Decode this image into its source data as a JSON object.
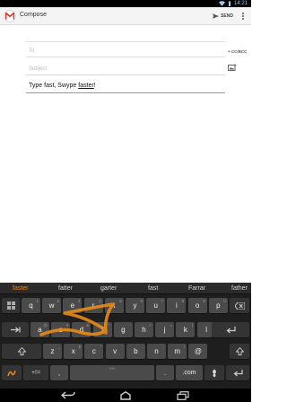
{
  "status_bar": {
    "time": "14:21",
    "icons": [
      "wifi-icon",
      "battery-icon"
    ]
  },
  "action_bar": {
    "title": "Compose",
    "send_label": "SEND",
    "icons": {
      "app": "gmail-logo-icon",
      "send": "send-icon",
      "menu": "overflow-menu-icon"
    }
  },
  "compose": {
    "to_placeholder": "To",
    "cc_bcc_label": "+ CC/BCC",
    "subject_placeholder": "Subject",
    "body_prefix": "Type fast, Swype ",
    "body_underlined": "faster",
    "body_suffix": "!"
  },
  "keyboard": {
    "suggestions": [
      "faster",
      "fatter",
      "garter",
      "fast",
      "Farrar",
      "father"
    ],
    "active_suggestion": "faster",
    "trace_color": "#e98a18",
    "row1": [
      {
        "label": "q",
        "alt": "1"
      },
      {
        "label": "w",
        "alt": "2"
      },
      {
        "label": "e",
        "alt": "3"
      },
      {
        "label": "r",
        "alt": "4"
      },
      {
        "label": "t",
        "alt": "5"
      },
      {
        "label": "y",
        "alt": "6"
      },
      {
        "label": "u",
        "alt": "7"
      },
      {
        "label": "i",
        "alt": "8"
      },
      {
        "label": "o",
        "alt": "9"
      },
      {
        "label": "p",
        "alt": "0"
      }
    ],
    "row2": [
      {
        "label": "a",
        "alt": "@"
      },
      {
        "label": "s",
        "alt": "#"
      },
      {
        "label": "d",
        "alt": "&"
      },
      {
        "label": "f",
        "alt": "*"
      },
      {
        "label": "g",
        "alt": "-"
      },
      {
        "label": "h",
        "alt": "+"
      },
      {
        "label": "j",
        "alt": "="
      },
      {
        "label": "k",
        "alt": "("
      },
      {
        "label": "l",
        "alt": ")"
      }
    ],
    "row3": [
      {
        "label": "z",
        "alt": "_"
      },
      {
        "label": "x",
        "alt": "$"
      },
      {
        "label": "c",
        "alt": "\""
      },
      {
        "label": "v",
        "alt": "'"
      },
      {
        "label": "b",
        "alt": ":"
      },
      {
        "label": "n",
        "alt": ";"
      },
      {
        "label": "m",
        "alt": "/"
      },
      {
        "label": "@",
        "alt": ""
      }
    ],
    "symbols_label": "+!=",
    "comma_label": ",",
    "space_sub_label": "EN",
    "period_label": ".",
    "dotcom_label": ".com",
    "icons": {
      "settings": "keypad-icon",
      "backspace": "backspace-icon",
      "tab": "tab-icon",
      "shift": "shift-icon",
      "enter": "enter-icon",
      "swype": "swype-logo-icon",
      "dragon": "dragon-mic-icon"
    }
  },
  "nav_bar": {
    "icons": [
      "back-icon",
      "home-icon",
      "recents-icon"
    ]
  }
}
